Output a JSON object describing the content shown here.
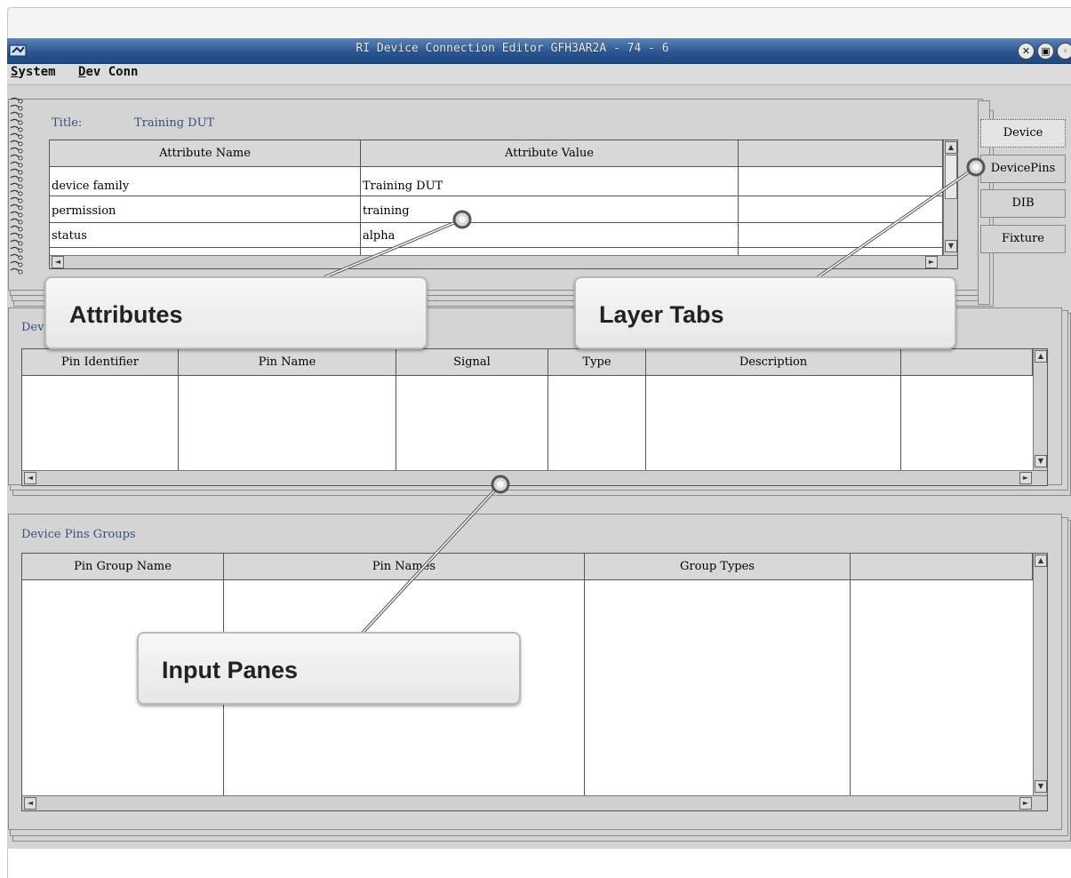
{
  "window": {
    "title": "RI Device Connection Editor GFH3AR2A - 74 - 6",
    "controls": [
      "close",
      "maximize",
      "minimize"
    ]
  },
  "menu": {
    "system": "System",
    "system_mnemonic": "S",
    "dev_conn": "Dev Conn",
    "dev_conn_mnemonic": "D"
  },
  "attributes_pane": {
    "title_label": "Title:",
    "title_value": "Training DUT",
    "headers": [
      "Attribute Name",
      "Attribute Value",
      ""
    ],
    "rows": [
      [
        "device family",
        "Training DUT",
        ""
      ],
      [
        "permission",
        "training",
        ""
      ],
      [
        "status",
        "alpha",
        ""
      ]
    ]
  },
  "device_pins_pane": {
    "label": "Dev",
    "headers": [
      "Pin Identifier",
      "Pin Name",
      "Signal",
      "Type",
      "Description",
      ""
    ]
  },
  "pin_groups_pane": {
    "label": "Device Pins Groups",
    "headers": [
      "Pin Group Name",
      "Pin Names",
      "Group Types",
      ""
    ]
  },
  "layer_tabs": [
    "Device",
    "DevicePins",
    "DIB",
    "Fixture"
  ],
  "active_tab": "Device",
  "callouts": {
    "attributes": "Attributes",
    "layer_tabs": "Layer Tabs",
    "input_panes": "Input Panes"
  },
  "colors": {
    "titlebar": "#2a5591",
    "pane_label": "#37507a",
    "background": "#d4d4d4"
  }
}
